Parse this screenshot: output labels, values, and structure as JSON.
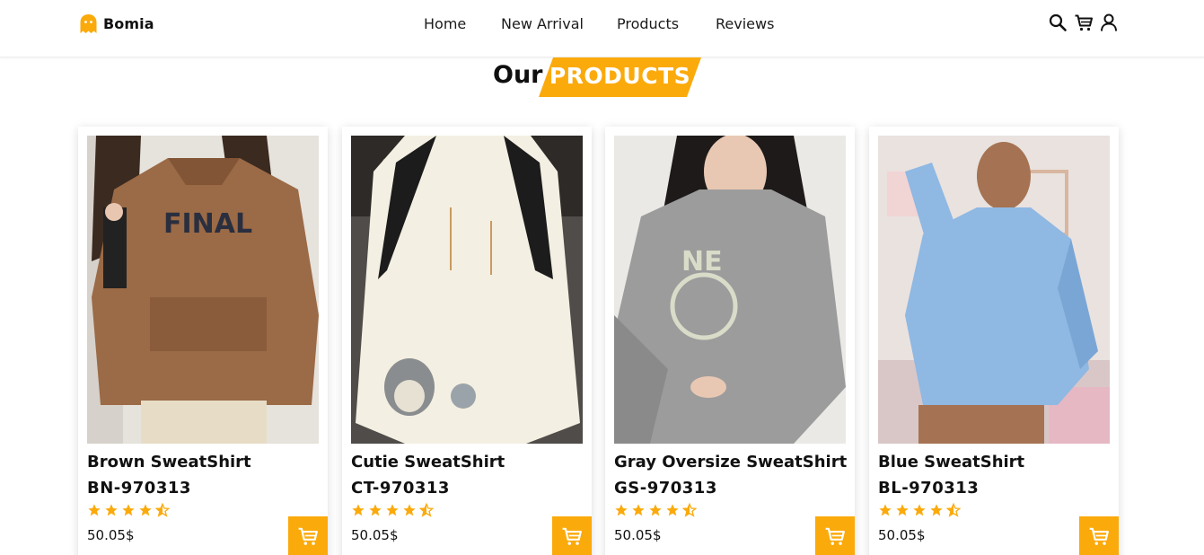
{
  "brand": {
    "name": "Bomia",
    "logo_icon": "ghost-icon",
    "color": "#fbaa0c"
  },
  "nav": {
    "items": [
      {
        "label": "Home"
      },
      {
        "label": "New Arrival"
      },
      {
        "label": "Products"
      },
      {
        "label": "Reviews"
      }
    ]
  },
  "toolbar": {
    "icons": [
      "search-icon",
      "cart-icon",
      "user-icon"
    ]
  },
  "section": {
    "title_plain": "Our",
    "title_highlight": "PRODUCTS",
    "accent_color": "#fbaa0c"
  },
  "products": [
    {
      "name": "Brown SweatShirt",
      "code": "BN-970313",
      "price": "50.05$",
      "rating": 4.5,
      "image_icon": "brown-hoodie-photo"
    },
    {
      "name": "Cutie SweatShirt",
      "code": "CT-970313",
      "price": "50.05$",
      "rating": 4.5,
      "image_icon": "cream-totoro-sweatshirt-photo"
    },
    {
      "name": "Gray Oversize SweatShirt",
      "code": "GS-970313",
      "price": "50.05$",
      "rating": 4.5,
      "image_icon": "gray-oversize-sweatshirt-photo"
    },
    {
      "name": "Blue SweatShirt",
      "code": "BL-970313",
      "price": "50.05$",
      "rating": 4.5,
      "image_icon": "blue-hoodie-photo"
    }
  ],
  "colors": {
    "accent": "#fbaa0c",
    "text": "#111111"
  }
}
